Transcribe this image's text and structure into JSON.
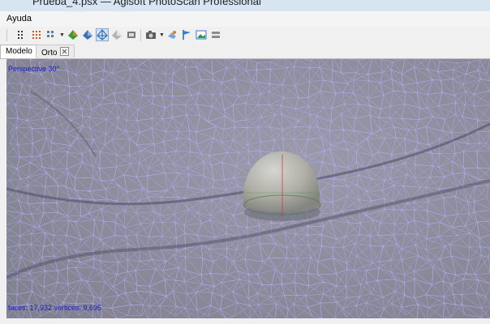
{
  "window": {
    "title": "Prueba_4.psx — Agisoft PhotoScan Professional"
  },
  "menu": {
    "items": [
      "Ayuda"
    ]
  },
  "toolbar": {
    "icons": [
      "grip-icon",
      "points-icon",
      "dense-points-icon",
      "tiled-points-icon",
      "dropdown-arrow-icon",
      "solid-model-icon",
      "shaded-model-icon",
      "wireframe-model-icon",
      "textured-model-icon",
      "cameras-icon",
      "camera-tool-icon",
      "dropdown-arrow-icon",
      "reset-view-icon",
      "markers-icon",
      "image-icon",
      "shapes-icon"
    ],
    "active": "wireframe-model-icon"
  },
  "tabs": [
    {
      "label": "Modelo",
      "active": true
    },
    {
      "label": "Orto",
      "active": false
    }
  ],
  "viewport": {
    "projection_label": "Perspective 30°",
    "stats_label": "faces: 17,932 vertices: 9,695",
    "mesh_color": "#b3b3ff",
    "background_color": "#8e8e9f"
  },
  "colors": {
    "accent": "#1818cc",
    "titlebar": "#d7e4f2"
  }
}
